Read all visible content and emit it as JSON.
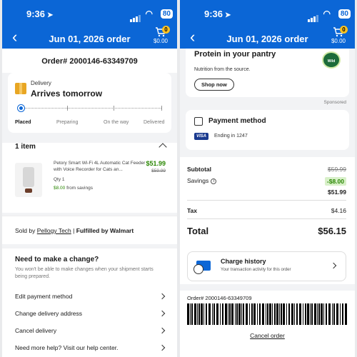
{
  "status_bar": {
    "time": "9:36",
    "battery": "80"
  },
  "header": {
    "title": "Jun 01, 2026 order",
    "cart_count": "0",
    "cart_total": "$0.00"
  },
  "order": {
    "number": "Order# 2000146-63349709"
  },
  "delivery": {
    "label": "Delivery",
    "title": "Arrives tomorrow",
    "steps": [
      "Placed",
      "Preparing",
      "On the way",
      "Delivered"
    ],
    "current_step": "Placed"
  },
  "items": {
    "count_label": "1 item",
    "list": [
      {
        "name": "Petory Smart Wi-Fi 4L Automatic Cat Feeder with Voice Recorder for Cats an...",
        "price": "$51.99",
        "was_price": "$59.99",
        "qty": "Qty 1",
        "savings_amount": "$8.00",
        "savings_text": "from savings"
      }
    ]
  },
  "seller": {
    "prefix": "Sold by",
    "name": "Pellogy Tech",
    "separator": "|",
    "fulfilled": "Fulfilled by Walmart"
  },
  "change": {
    "heading": "Need to make a change?",
    "note": "You won't be able to make changes when your shipment starts being prepared.",
    "actions": [
      "Edit payment method",
      "Change delivery address",
      "Cancel delivery",
      "Need more help? Visit our help center."
    ]
  },
  "promo": {
    "title": "Protein in your pantry",
    "subtitle": "Nutrition from the source.",
    "button": "Shop now",
    "brand": "Wild Planet",
    "sponsored": "Sponsored"
  },
  "payment": {
    "title": "Payment method",
    "card_brand": "VISA",
    "ending": "Ending in 1247"
  },
  "totals": {
    "subtotal_label": "Subtotal",
    "subtotal_was": "$59.99",
    "savings_label": "Savings",
    "savings_value": "-$8.00",
    "subtotal_after": "$51.99",
    "tax_label": "Tax",
    "tax_value": "$4.16",
    "total_label": "Total",
    "total_value": "$56.15"
  },
  "charge_history": {
    "title": "Charge history",
    "subtitle": "Your transaction activity for this order"
  },
  "barcode": {
    "label": "Order# 2000146-63349709"
  },
  "cancel_order": "Cancel order",
  "colors": {
    "brand_blue": "#0b66d6",
    "savings_green": "#2a8703",
    "spark_yellow": "#ffc220"
  }
}
